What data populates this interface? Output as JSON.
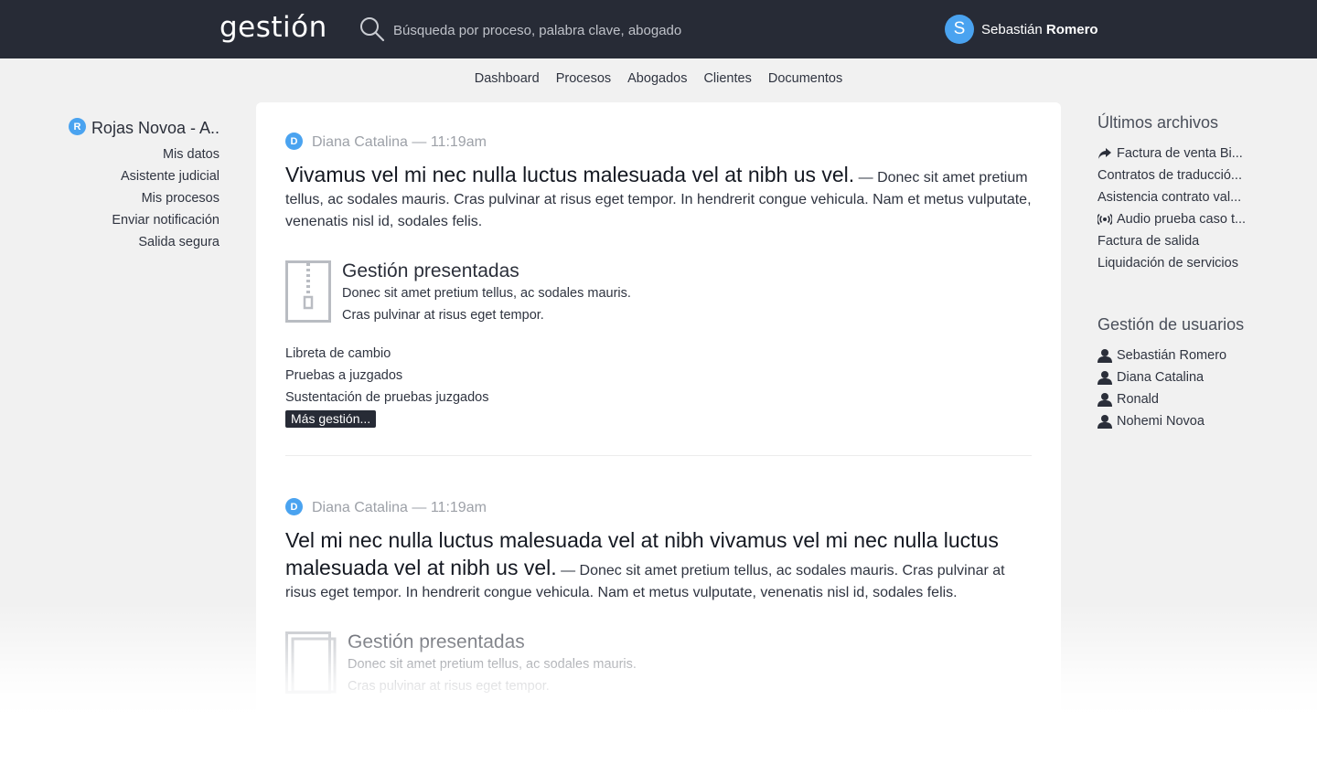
{
  "header": {
    "logo": "gestión",
    "search_placeholder": "Búsqueda por proceso, palabra clave, abogado",
    "user": {
      "initial": "S",
      "first_name": "Sebastián",
      "last_name": "Romero"
    }
  },
  "nav": [
    "Dashboard",
    "Procesos",
    "Abogados",
    "Clientes",
    "Documentos"
  ],
  "left": {
    "org_initial": "R",
    "org_name": "Rojas Novoa - A..",
    "menu": [
      "Mis datos",
      "Asistente judicial",
      "Mis procesos",
      "Enviar notificación",
      "Salida segura"
    ]
  },
  "posts": [
    {
      "author_initial": "D",
      "meta": "Diana Catalina — 11:19am",
      "title": "Vivamus vel mi nec nulla luctus malesuada vel at nibh us vel.",
      "excerpt": "— Donec sit amet pretium tellus, ac sodales mauris. Cras pulvinar at risus eget tempor. In hendrerit congue vehicula. Nam et metus vulputate, venenatis nisl id, sodales felis.",
      "attachment": {
        "title": "Gestión presentadas",
        "lines": [
          "Donec sit amet pretium tellus, ac sodales mauris.",
          "Cras pulvinar at risus eget tempor."
        ]
      },
      "links": [
        "Libreta de cambio",
        "Pruebas a juzgados",
        "Sustentación de pruebas juzgados"
      ],
      "more_label": "Más gestión..."
    },
    {
      "author_initial": "D",
      "meta": "Diana Catalina — 11:19am",
      "title": "Vel mi nec nulla luctus malesuada vel at nibh vivamus vel mi nec nulla luctus malesuada vel at nibh us vel.",
      "excerpt": "— Donec sit amet pretium tellus, ac sodales mauris. Cras pulvinar at risus eget tempor. In hendrerit congue vehicula. Nam et metus vulputate, venenatis nisl id, sodales felis.",
      "attachment": {
        "title": "Gestión presentadas",
        "lines": [
          "Donec sit amet pretium tellus, ac sodales mauris.",
          "Cras pulvinar at risus eget tempor."
        ]
      }
    }
  ],
  "right": {
    "files_title": "Últimos archivos",
    "files": [
      {
        "icon": "share-icon",
        "label": "Factura de venta Bi..."
      },
      {
        "icon": "",
        "label": "Contratos de traducció..."
      },
      {
        "icon": "",
        "label": "Asistencia contrato val..."
      },
      {
        "icon": "audio-icon",
        "label": "Audio prueba caso t..."
      },
      {
        "icon": "",
        "label": "Factura de salida"
      },
      {
        "icon": "",
        "label": "Liquidación de servicios"
      }
    ],
    "users_title": "Gestión de usuarios",
    "users": [
      "Sebastián Romero",
      "Diana Catalina",
      "Ronald",
      "Nohemi Novoa"
    ]
  },
  "colors": {
    "header_bg": "#272b36",
    "accent": "#4aa3f0",
    "page_bg": "#f1f1f1"
  }
}
